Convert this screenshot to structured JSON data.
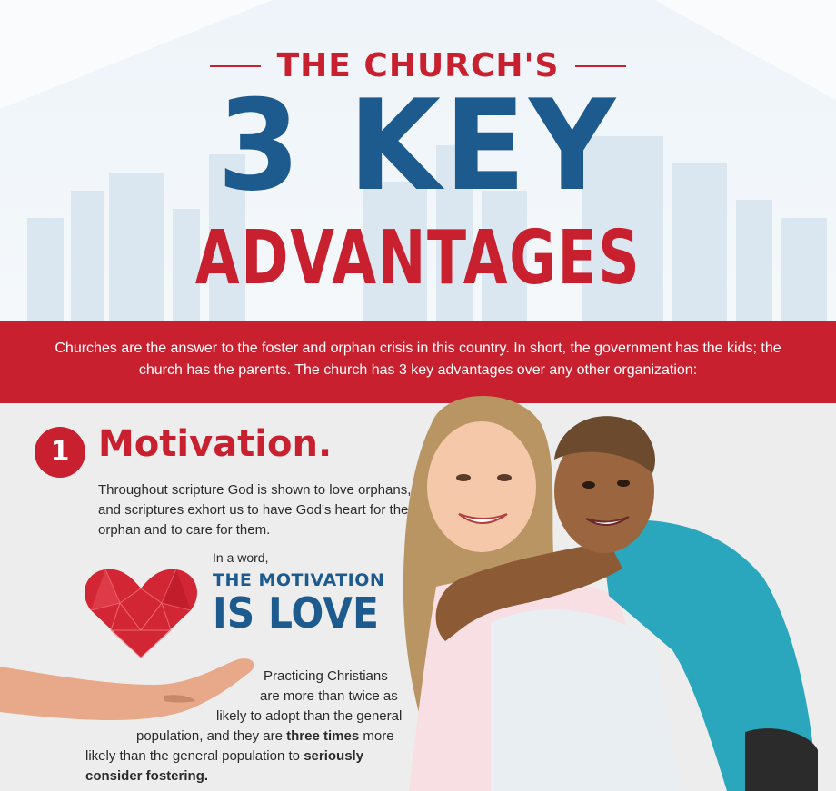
{
  "header": {
    "kicker": "THE CHURCH'S",
    "big": "3 KEY",
    "sub": "ADVANTAGES"
  },
  "banner": {
    "text": "Churches are the answer to the foster and orphan crisis in this country. In short, the government has the kids; the church has the parents. The church has 3 key advantages over any other organization:"
  },
  "section1": {
    "number": "1",
    "title": "Motivation.",
    "intro": "Throughout scripture God is shown to love orphans, and scriptures exhort us to have God's heart for the orphan and to care for them.",
    "in_a_word": "In a word,",
    "headline_1": "THE MOTIVATION",
    "headline_2": "IS LOVE",
    "stat_lines": [
      "Practicing Christians",
      "are more than twice as",
      "likely to adopt than the general",
      "population, and they are",
      "three times",
      "more",
      "likely than the general population to",
      "seriously",
      "consider fostering."
    ]
  },
  "colors": {
    "red": "#c8202f",
    "blue": "#1d5b8f",
    "banner_text": "#ffffff",
    "section_bg": "#ededed"
  },
  "icons": [
    "heart-icon",
    "hand-illustration",
    "skyline-illustration",
    "mother-and-child-illustration"
  ]
}
